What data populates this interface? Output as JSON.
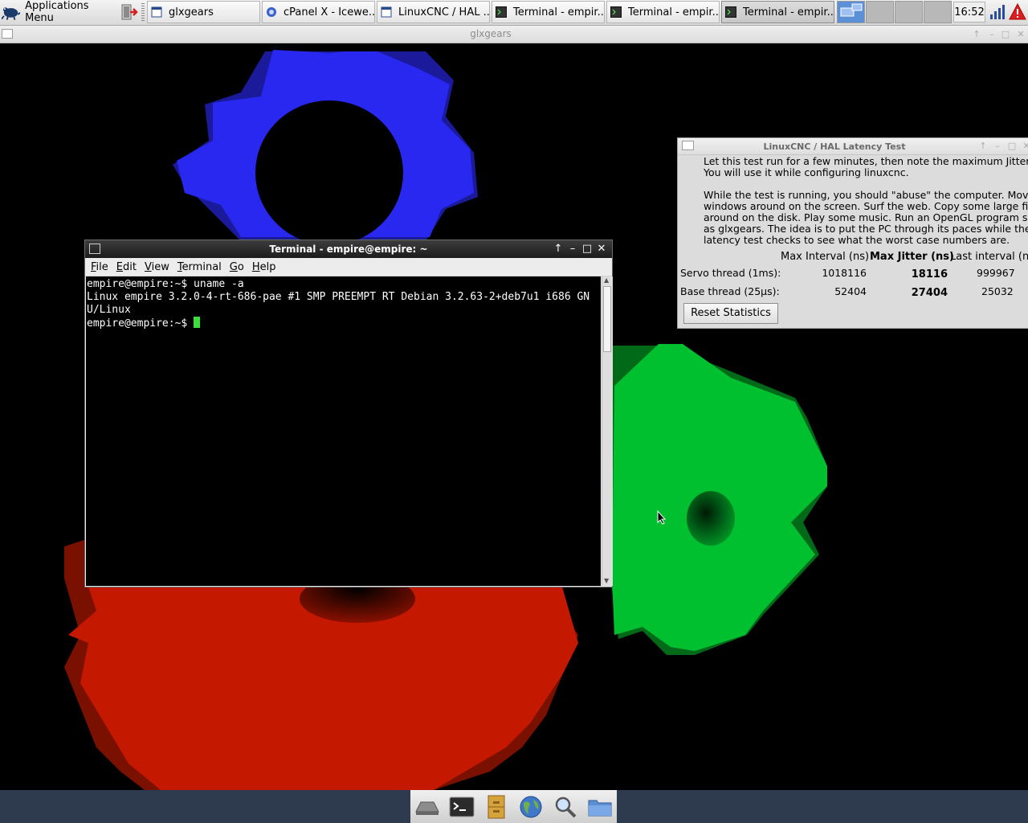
{
  "panel": {
    "app_menu_label": "Applications Menu",
    "tasks": [
      {
        "label": "glxgears",
        "icon": "window-icon"
      },
      {
        "label": "cPanel X - Icewe...",
        "icon": "browser-icon"
      },
      {
        "label": "LinuxCNC / HAL ...",
        "icon": "window-icon"
      },
      {
        "label": "Terminal - empir...",
        "icon": "terminal-icon"
      },
      {
        "label": "Terminal - empir...",
        "icon": "terminal-icon"
      },
      {
        "label": "Terminal - empir...",
        "icon": "terminal-icon"
      }
    ],
    "clock": "16:52"
  },
  "glx_window": {
    "title": "glxgears"
  },
  "terminal": {
    "title": "Terminal - empire@empire: ~",
    "menu": [
      "File",
      "Edit",
      "View",
      "Terminal",
      "Go",
      "Help"
    ],
    "lines": [
      "empire@empire:~$ uname -a",
      "Linux empire 3.2.0-4-rt-686-pae #1 SMP PREEMPT RT Debian 3.2.63-2+deb7u1 i686 GN",
      "U/Linux",
      "empire@empire:~$ "
    ]
  },
  "latency": {
    "title": "LinuxCNC / HAL Latency Test",
    "para1": "Let this test run for a few minutes, then note the maximum Jitter.\nYou will use it while configuring linuxcnc.",
    "para2": "While the test is running, you should \"abuse\" the computer. Move\nwindows around on the screen. Surf the web. Copy some large files\naround on the disk. Play some music. Run an OpenGL program such\nas glxgears. The idea is to put the PC through its paces while the\nlatency test checks to see what the worst case numbers are.",
    "col_max_interval": "Max Interval (ns)",
    "col_max_jitter": "Max Jitter (ns)",
    "col_last_interval": "Last interval (ns)",
    "servo_label": "Servo thread (1ms):",
    "servo_max_interval": "1018116",
    "servo_max_jitter": "18116",
    "servo_last_interval": "999967",
    "base_label": "Base thread (25µs):",
    "base_max_interval": "52404",
    "base_max_jitter": "27404",
    "base_last_interval": "25032",
    "reset_label": "Reset Statistics"
  },
  "colors": {
    "gear_red": "#c41800",
    "gear_green": "#00c030",
    "gear_blue": "#2828f0",
    "cursor": "#3adf3a"
  }
}
